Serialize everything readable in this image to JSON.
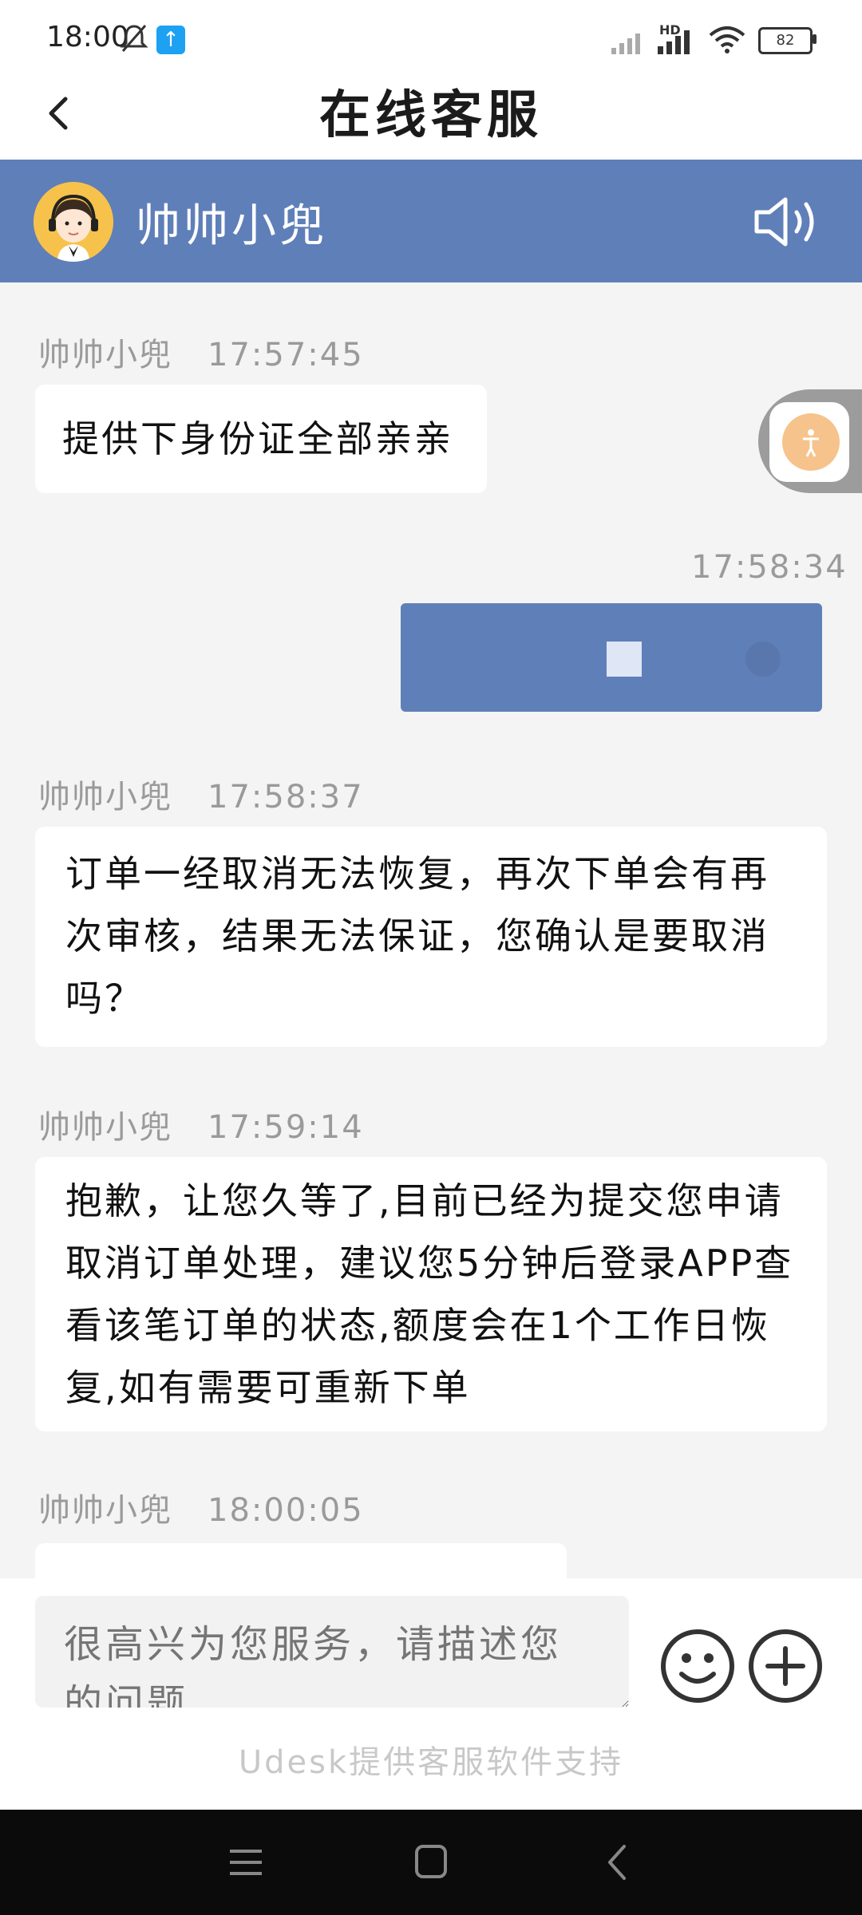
{
  "status_bar": {
    "time": "18:00",
    "battery": "82",
    "network_label": "HD"
  },
  "header": {
    "title": "在线客服",
    "back_icon": "chevron-left-icon"
  },
  "agent": {
    "name": "帅帅小兜",
    "avatar_icon": "headset-agent-avatar",
    "speaker_icon": "speaker-icon"
  },
  "messages": [
    {
      "sender": "帅帅小兜",
      "time": "17:57:45",
      "text": "提供下身份证全部亲亲"
    },
    {
      "sender": "me",
      "time": "17:58:34",
      "text": ""
    },
    {
      "sender": "帅帅小兜",
      "time": "17:58:37",
      "lines": [
        "订单一经取消无法恢复，再次下单会有再",
        "次审核，结果无法保证，您确认是要取消",
        "吗？"
      ]
    },
    {
      "sender": "帅帅小兜",
      "time": "17:59:14",
      "lines": [
        "抱歉，让您久等了,目前已经为提交您申请",
        "取消订单处理，建议您5分钟后登录APP查",
        "看该笔订单的状态,额度会在1个工作日恢",
        "复,如有需要可重新下单"
      ]
    },
    {
      "sender": "帅帅小兜",
      "time": "18:00:05",
      "text": ""
    }
  ],
  "input": {
    "placeholder": "很高兴为您服务，请描述您的问题"
  },
  "footer": {
    "powered_by": "Udesk提供客服软件支持"
  },
  "colors": {
    "accent": "#5f7fb9",
    "background": "#f4f4f4",
    "avatar_bg": "#f7c24c"
  }
}
